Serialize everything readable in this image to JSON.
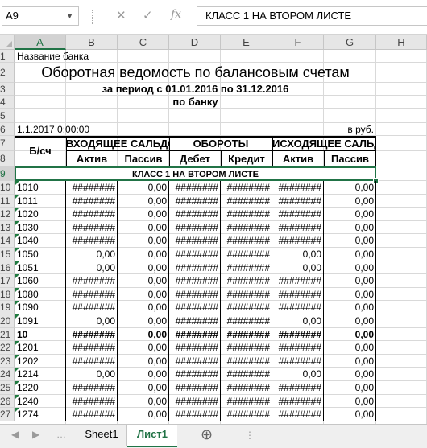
{
  "formula_bar": {
    "name_box": "A9",
    "cancel_icon": "✕",
    "enter_icon": "✓",
    "fx_label": "fx",
    "content": "КЛАСС  1  НА ВТОРОМ ЛИСТЕ"
  },
  "columns": [
    "A",
    "B",
    "C",
    "D",
    "E",
    "F",
    "G",
    "H"
  ],
  "selected_cell": "A9",
  "report": {
    "bank_label": "Название банка",
    "title": "Оборотная ведомость по балансовым счетам",
    "period": "за период с 01.01.2016 по 31.12.2016",
    "scope": "по банку",
    "date": "1.1.2017 0:00:00",
    "currency": "в руб.",
    "header_account": "Б/сч",
    "header_opening": "ВХОДЯЩЕЕ САЛЬДО",
    "header_turnover": "ОБОРОТЫ",
    "header_closing": "ИСХОДЯЩЕЕ САЛЬДО",
    "sub_active_1": "Актив",
    "sub_passive_1": "Пассив",
    "sub_debit": "Дебет",
    "sub_credit": "Кредит",
    "sub_active_2": "Актив",
    "sub_passive_2": "Пассив",
    "class_label": "КЛАСС  1  НА ВТОРОМ ЛИСТЕ"
  },
  "rows": [
    {
      "row": "10",
      "account": "1010",
      "b": "########",
      "c": "0,00",
      "d": "########",
      "e": "########",
      "f": "########",
      "g": "0,00",
      "bold": false,
      "flag": true
    },
    {
      "row": "11",
      "account": "1011",
      "b": "########",
      "c": "0,00",
      "d": "########",
      "e": "########",
      "f": "########",
      "g": "0,00",
      "bold": false,
      "flag": true
    },
    {
      "row": "12",
      "account": "1020",
      "b": "########",
      "c": "0,00",
      "d": "########",
      "e": "########",
      "f": "########",
      "g": "0,00",
      "bold": false,
      "flag": true
    },
    {
      "row": "13",
      "account": "1030",
      "b": "########",
      "c": "0,00",
      "d": "########",
      "e": "########",
      "f": "########",
      "g": "0,00",
      "bold": false,
      "flag": true
    },
    {
      "row": "14",
      "account": "1040",
      "b": "########",
      "c": "0,00",
      "d": "########",
      "e": "########",
      "f": "########",
      "g": "0,00",
      "bold": false,
      "flag": true
    },
    {
      "row": "15",
      "account": "1050",
      "b": "0,00",
      "c": "0,00",
      "d": "########",
      "e": "########",
      "f": "0,00",
      "g": "0,00",
      "bold": false,
      "flag": true
    },
    {
      "row": "16",
      "account": "1051",
      "b": "0,00",
      "c": "0,00",
      "d": "########",
      "e": "########",
      "f": "0,00",
      "g": "0,00",
      "bold": false,
      "flag": true
    },
    {
      "row": "17",
      "account": "1060",
      "b": "########",
      "c": "0,00",
      "d": "########",
      "e": "########",
      "f": "########",
      "g": "0,00",
      "bold": false,
      "flag": true
    },
    {
      "row": "18",
      "account": "1080",
      "b": "########",
      "c": "0,00",
      "d": "########",
      "e": "########",
      "f": "########",
      "g": "0,00",
      "bold": false,
      "flag": true
    },
    {
      "row": "19",
      "account": "1090",
      "b": "########",
      "c": "0,00",
      "d": "########",
      "e": "########",
      "f": "########",
      "g": "0,00",
      "bold": false,
      "flag": true
    },
    {
      "row": "20",
      "account": "1091",
      "b": "0,00",
      "c": "0,00",
      "d": "########",
      "e": "########",
      "f": "0,00",
      "g": "0,00",
      "bold": false,
      "flag": true
    },
    {
      "row": "21",
      "account": "10",
      "b": "########",
      "c": "0,00",
      "d": "########",
      "e": "########",
      "f": "########",
      "g": "0,00",
      "bold": true,
      "flag": false
    },
    {
      "row": "22",
      "account": "1201",
      "b": "########",
      "c": "0,00",
      "d": "########",
      "e": "########",
      "f": "########",
      "g": "0,00",
      "bold": false,
      "flag": true
    },
    {
      "row": "23",
      "account": "1202",
      "b": "########",
      "c": "0,00",
      "d": "########",
      "e": "########",
      "f": "########",
      "g": "0,00",
      "bold": false,
      "flag": true
    },
    {
      "row": "24",
      "account": "1214",
      "b": "0,00",
      "c": "0,00",
      "d": "########",
      "e": "########",
      "f": "0,00",
      "g": "0,00",
      "bold": false,
      "flag": true
    },
    {
      "row": "25",
      "account": "1220",
      "b": "########",
      "c": "0,00",
      "d": "########",
      "e": "########",
      "f": "########",
      "g": "0,00",
      "bold": false,
      "flag": true
    },
    {
      "row": "26",
      "account": "1240",
      "b": "########",
      "c": "0,00",
      "d": "########",
      "e": "########",
      "f": "########",
      "g": "0,00",
      "bold": false,
      "flag": true
    },
    {
      "row": "27",
      "account": "1274",
      "b": "########",
      "c": "0,00",
      "d": "########",
      "e": "########",
      "f": "########",
      "g": "0,00",
      "bold": false,
      "flag": true
    }
  ],
  "sheets": [
    "Sheet1",
    "Лист1"
  ],
  "active_sheet": "Лист1",
  "add_sheet_icon": "⊕",
  "colors": {
    "accent": "#217346",
    "header_bg": "#e6e6e6",
    "gridline": "#d9d9d9"
  }
}
